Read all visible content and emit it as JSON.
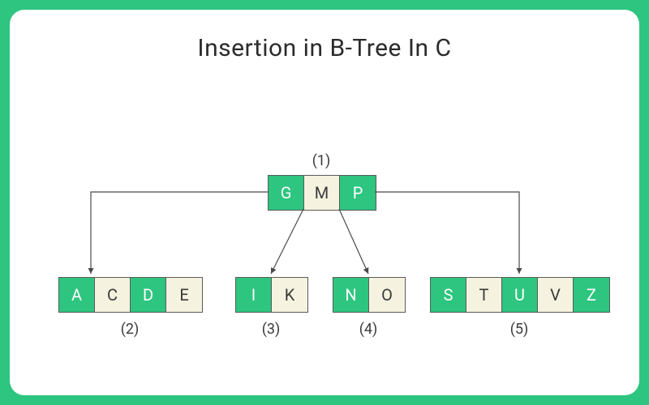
{
  "title": "Insertion in B-Tree In C",
  "labels": {
    "l1": "(1)",
    "l2": "(2)",
    "l3": "(3)",
    "l4": "(4)",
    "l5": "(5)"
  },
  "root": {
    "c0": "G",
    "c1": "M",
    "c2": "P"
  },
  "child1": {
    "c0": "A",
    "c1": "C",
    "c2": "D",
    "c3": "E"
  },
  "child2": {
    "c0": "I",
    "c1": "K"
  },
  "child3": {
    "c0": "N",
    "c1": "O"
  },
  "child4": {
    "c0": "S",
    "c1": "T",
    "c2": "U",
    "c3": "V",
    "c4": "Z"
  },
  "colors": {
    "accent": "#2dc57f",
    "cream": "#f5f3e0",
    "border": "#5a5a5a"
  }
}
